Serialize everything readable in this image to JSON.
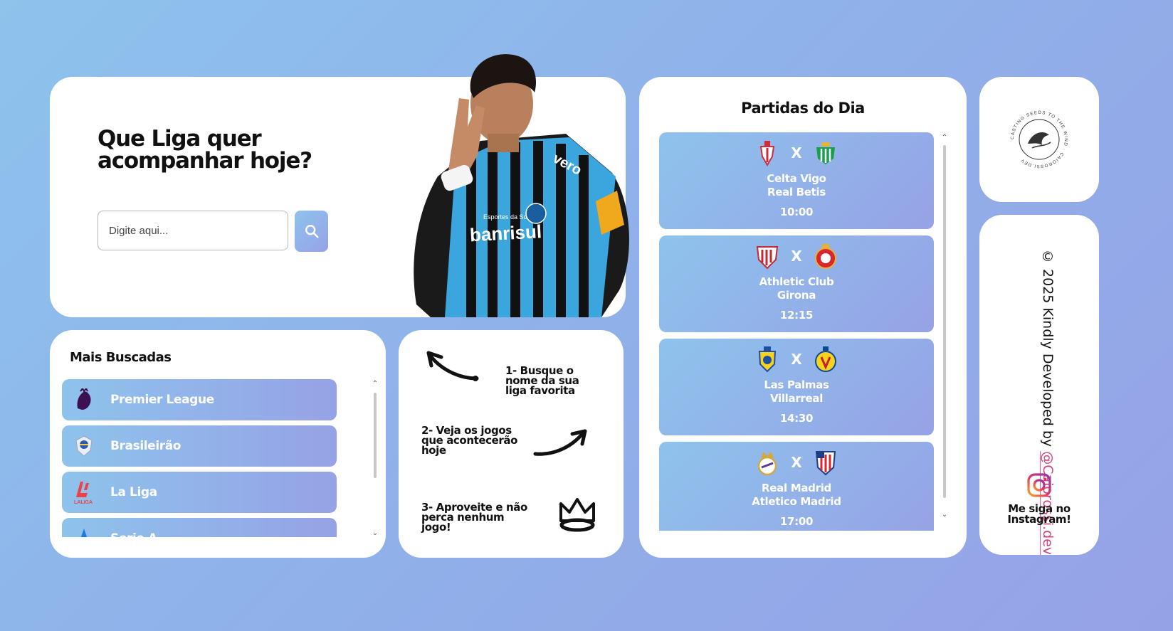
{
  "hero": {
    "title": "Que Liga quer acompanhar hoje?",
    "search_placeholder": "Digite aqui...",
    "photo_text": {
      "sponsor": "banrisul",
      "brand": "vero",
      "shirt": "Esportes da Sorte",
      "badge": "GRÊMIO"
    }
  },
  "mais_buscadas": {
    "title": "Mais Buscadas",
    "items": [
      {
        "label": "Premier League",
        "icon": "premier-league-logo"
      },
      {
        "label": "Brasileirão",
        "icon": "brasileirao-logo"
      },
      {
        "label": "La Liga",
        "icon": "laliga-logo"
      },
      {
        "label": "Serie A",
        "icon": "serie-a-logo"
      }
    ]
  },
  "steps": {
    "step1": "1- Busque o nome da sua liga favorita",
    "step2": "2- Veja os jogos que acontecerão hoje",
    "step3": "3- Aproveite e não perca nenhum jogo!"
  },
  "partidas": {
    "title": "Partidas do Dia",
    "vs_label": "X",
    "matches": [
      {
        "home": "Celta Vigo",
        "away": "Real Betis",
        "time": "10:00"
      },
      {
        "home": "Athletic Club",
        "away": "Girona",
        "time": "12:15"
      },
      {
        "home": "Las Palmas",
        "away": "Villarreal",
        "time": "14:30"
      },
      {
        "home": "Real Madrid",
        "away": "Atletico Madrid",
        "time": "17:00"
      }
    ]
  },
  "logo": {
    "ring_text": "CASTING SEEDS TO THE WIND · CAIOROSSI.DEV"
  },
  "credits": {
    "text": "© 2025 Kindly Developed by ",
    "handle": "@Caiorossi.dev",
    "instagram_label": "Me siga no Instagram!"
  },
  "colors": {
    "gradient_start": "#8ec3ec",
    "gradient_end": "#96a2e6",
    "handle": "#d0457c"
  }
}
